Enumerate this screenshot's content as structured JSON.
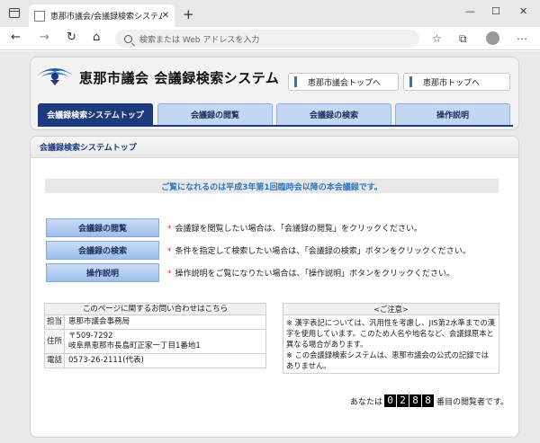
{
  "browser": {
    "tab_title": "恵那市議会/会議録検索システム",
    "tab_close": "✕",
    "new_tab": "+",
    "address_placeholder": "検索または Web アドレスを入力",
    "controls": {
      "minimize": "—",
      "maximize": "☐",
      "close": "✕"
    },
    "nav": {
      "back": "←",
      "forward": "→",
      "reload": "↻",
      "home": "⌂"
    },
    "icons": {
      "favorites": "☆",
      "collections": "⧉",
      "menu": "⋯"
    }
  },
  "header": {
    "site_title": "恵那市議会 会議録検索システム",
    "links": [
      "恵那市議会トップへ",
      "恵那市トップへ"
    ]
  },
  "nav_tabs": [
    "会議録検索システムトップ",
    "会議録の閲覧",
    "会議録の検索",
    "操作説明"
  ],
  "main": {
    "section_title": "会議録検索システムトップ",
    "notice": "ご覧になれるのは平成3年第1回臨時会以降の本会議録です。",
    "menu": [
      {
        "label": "会議録の閲覧",
        "description": "会議録を閲覧したい場合は、「会議録の閲覧」をクリックください。"
      },
      {
        "label": "会議録の検索",
        "description": "条件を指定して検索したい場合は、「会議録の検索」ボタンをクリックください。"
      },
      {
        "label": "操作説明",
        "description": "操作説明をご覧になりたい場合は、「操作説明」ボタンをクリックください。"
      }
    ],
    "star": "*"
  },
  "contact": {
    "heading": "このページに関するお問い合わせはこちら",
    "rows": [
      {
        "key": "担当",
        "value": "恵那市議会事務局"
      },
      {
        "key": "住所",
        "value_lines": [
          "〒509-7292",
          "岐阜県恵那市長島町正家一丁目1番地1"
        ]
      },
      {
        "key": "電話",
        "value": "0573-26-2111(代表)"
      }
    ]
  },
  "caution": {
    "heading": "<ご注意>",
    "lines": [
      "※ 漢字表記については、汎用性を考慮し、JIS第2水準までの漢字を使用しています。このため人名や地名など、会議録原本と異なる場合があります。",
      "※ この会議録検索システムは、恵那市議会の公式の記録ではありません。"
    ]
  },
  "counter": {
    "prefix": "あなたは",
    "digits": [
      "0",
      "2",
      "8",
      "8"
    ],
    "suffix": "番目の閲覧者です。"
  },
  "colors": {
    "nav_active": "#1c3a7e",
    "nav_normal": "#c3d6f2",
    "notice_text": "#2f78c2",
    "star": "#d23030"
  }
}
